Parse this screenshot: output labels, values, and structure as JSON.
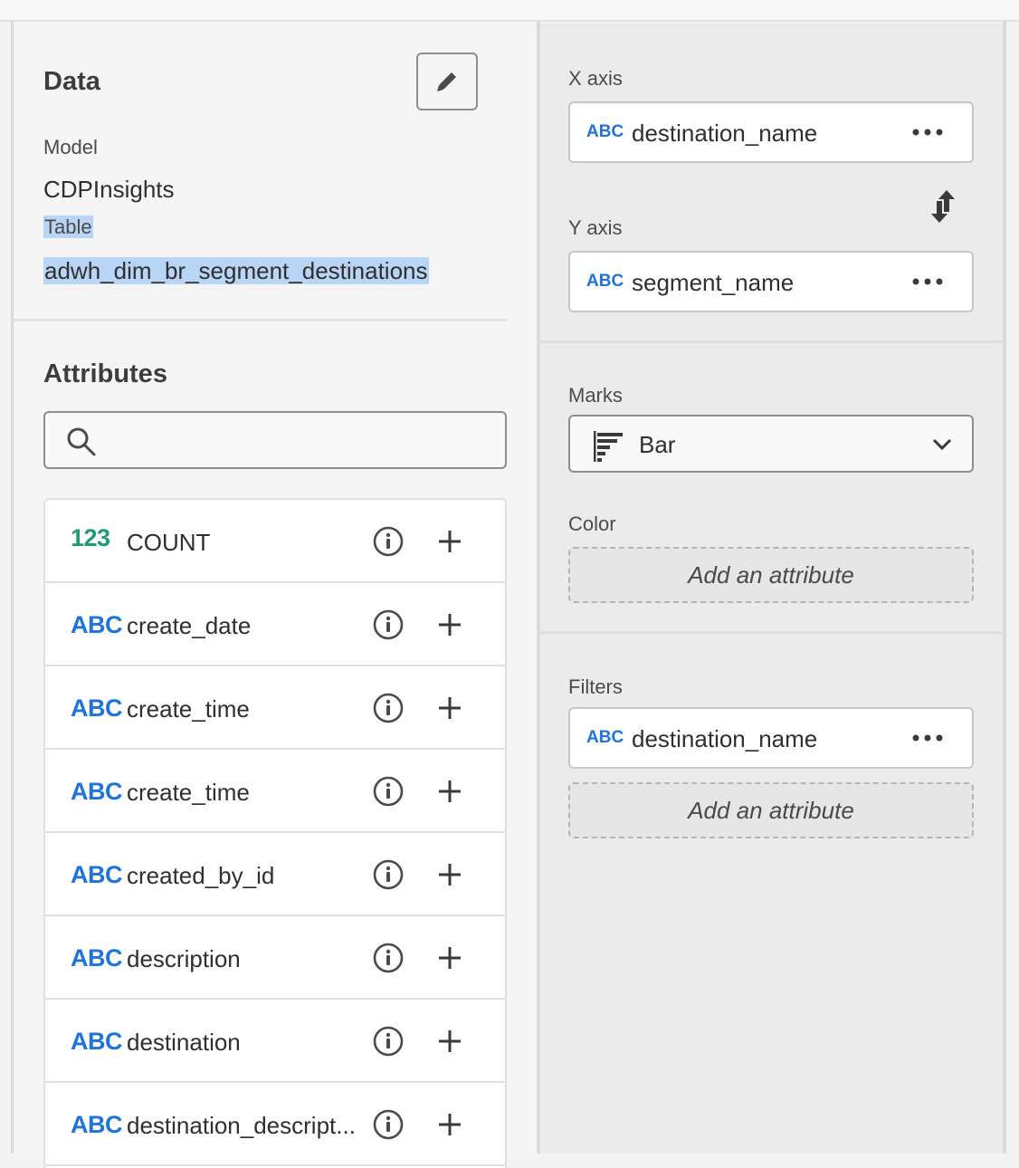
{
  "data_panel": {
    "title": "Data",
    "edit_button_icon": "pencil-icon",
    "model_label": "Model",
    "model_value": "CDPInsights",
    "table_label": "Table",
    "table_value": "adwh_dim_br_segment_destinations"
  },
  "attributes": {
    "title": "Attributes",
    "search": {
      "placeholder": "",
      "value": "",
      "icon": "search-icon"
    },
    "items": [
      {
        "type": "123",
        "name": "COUNT"
      },
      {
        "type": "ABC",
        "name": "create_date"
      },
      {
        "type": "ABC",
        "name": "create_time"
      },
      {
        "type": "ABC",
        "name": "create_time"
      },
      {
        "type": "ABC",
        "name": "created_by_id"
      },
      {
        "type": "ABC",
        "name": "description"
      },
      {
        "type": "ABC",
        "name": "destination"
      },
      {
        "type": "ABC",
        "name": "destination_descript..."
      }
    ]
  },
  "encoding": {
    "x_axis": {
      "label": "X axis",
      "type": "ABC",
      "field": "destination_name"
    },
    "y_axis": {
      "label": "Y axis",
      "type": "ABC",
      "field": "segment_name"
    },
    "swap_icon": "swap-axes-icon",
    "marks": {
      "label": "Marks",
      "value": "Bar",
      "icon": "bar-chart-icon"
    },
    "color": {
      "label": "Color",
      "add_label": "Add an attribute"
    },
    "filters": {
      "label": "Filters",
      "type": "ABC",
      "field": "destination_name",
      "add_label": "Add an attribute"
    }
  },
  "colors": {
    "string_type": "#1f74d9",
    "number_type": "#1e9b6f",
    "selection": "#b9d5f6"
  }
}
